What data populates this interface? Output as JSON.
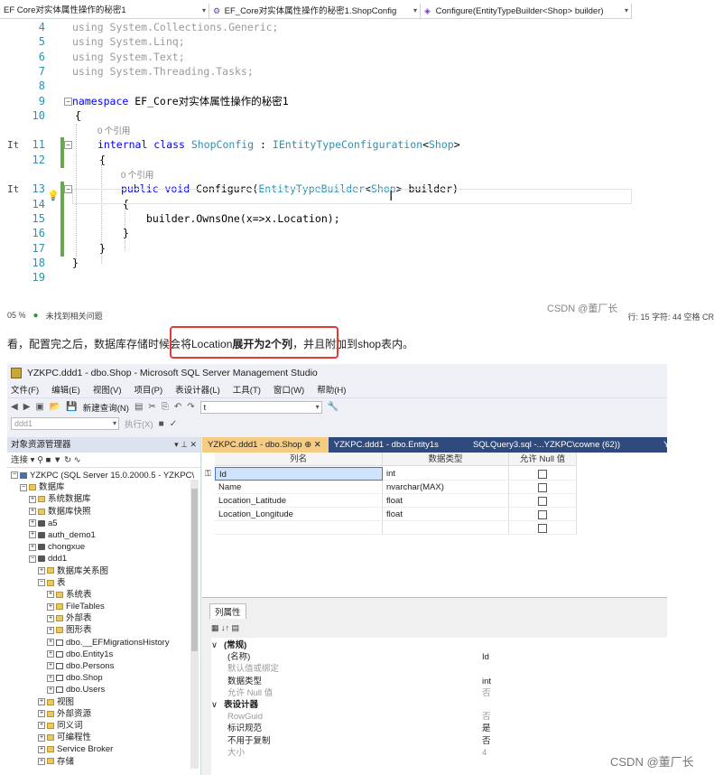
{
  "vs": {
    "nav": {
      "project": "EF Core对实体属性操作的秘密1",
      "type": "EF_Core对实体属性操作的秘密1.ShopConfig",
      "member": "Configure(EntityTypeBuilder<Shop> builder)"
    },
    "lines": [
      {
        "n": "4",
        "parts": [
          {
            "c": "us",
            "t": "using System.Collections.Generic;"
          }
        ]
      },
      {
        "n": "5",
        "parts": [
          {
            "c": "us",
            "t": "using System.Linq;"
          }
        ]
      },
      {
        "n": "6",
        "parts": [
          {
            "c": "us",
            "t": "using System.Text;"
          }
        ]
      },
      {
        "n": "7",
        "parts": [
          {
            "c": "us",
            "t": "using System.Threading.Tasks;"
          }
        ]
      },
      {
        "n": "8",
        "parts": []
      },
      {
        "n": "9",
        "parts": [
          {
            "c": "kw",
            "t": "namespace"
          },
          {
            "c": "pl",
            "t": " EF_Core对实体属性操作的秘密1"
          }
        ]
      },
      {
        "n": "10",
        "parts": [
          {
            "c": "pl",
            "t": "{"
          }
        ]
      },
      {
        "n": "",
        "ref": "0 个引用"
      },
      {
        "n": "11",
        "parts": [
          {
            "c": "kw",
            "t": "internal class "
          },
          {
            "c": "ty",
            "t": "ShopConfig"
          },
          {
            "c": "pl",
            "t": " : "
          },
          {
            "c": "ty",
            "t": "IEntityTypeConfiguration"
          },
          {
            "c": "pl",
            "t": "<"
          },
          {
            "c": "ty",
            "t": "Shop"
          },
          {
            "c": "pl",
            "t": ">"
          }
        ]
      },
      {
        "n": "12",
        "parts": [
          {
            "c": "pl",
            "t": "{"
          }
        ]
      },
      {
        "n": "",
        "ref": "0 个引用"
      },
      {
        "n": "13",
        "parts": [
          {
            "c": "kw",
            "t": "public void "
          },
          {
            "c": "pl",
            "t": "Configure("
          },
          {
            "c": "ty",
            "t": "EntityTypeBuilder"
          },
          {
            "c": "pl",
            "t": "<"
          },
          {
            "c": "ty",
            "t": "Shop"
          },
          {
            "c": "pl",
            "t": "> builder)"
          }
        ]
      },
      {
        "n": "14",
        "parts": [
          {
            "c": "pl",
            "t": "{"
          }
        ]
      },
      {
        "n": "15",
        "parts": [
          {
            "c": "pl",
            "t": "builder.OwnsOne(x=>x.Location);"
          }
        ]
      },
      {
        "n": "16",
        "parts": [
          {
            "c": "pl",
            "t": "}"
          }
        ]
      },
      {
        "n": "17",
        "parts": [
          {
            "c": "pl",
            "t": "}"
          }
        ]
      },
      {
        "n": "18",
        "parts": [
          {
            "c": "pl",
            "t": "}"
          }
        ]
      },
      {
        "n": "19",
        "parts": []
      }
    ],
    "status": {
      "zoom": "05 %",
      "issues": "未找到相关问题",
      "position": "行: 15    字符: 44    空格    CR"
    },
    "watermark": "CSDN @董厂长"
  },
  "caption": {
    "before": "看，配置完之后，数据库存储时候会将Location",
    "bold": "展开为2个列",
    "after": "，并且附加到shop表内。"
  },
  "ssms": {
    "title": "YZKPC.ddd1 - dbo.Shop - Microsoft SQL Server Management Studio",
    "menu": [
      "文件(F)",
      "编辑(E)",
      "视图(V)",
      "项目(P)",
      "表设计器(L)",
      "工具(T)",
      "窗口(W)",
      "帮助(H)"
    ],
    "toolbar": {
      "new_query": "新建查询(N)",
      "db_combo": "ddd1",
      "execute": "执行(X)",
      "search_combo": "t"
    },
    "object_explorer": {
      "title": "对象资源管理器",
      "connect": "连接",
      "nodes": [
        {
          "label": "YZKPC (SQL Server 15.0.2000.5 - YZKPC\\",
          "indent": 0,
          "exp": "−",
          "icon": "srv"
        },
        {
          "label": "数据库",
          "indent": 1,
          "exp": "−",
          "icon": "folder"
        },
        {
          "label": "系统数据库",
          "indent": 2,
          "exp": "+",
          "icon": "folder"
        },
        {
          "label": "数据库快照",
          "indent": 2,
          "exp": "+",
          "icon": "folder"
        },
        {
          "label": "a5",
          "indent": 2,
          "exp": "+",
          "icon": "db"
        },
        {
          "label": "auth_demo1",
          "indent": 2,
          "exp": "+",
          "icon": "db"
        },
        {
          "label": "chongxue",
          "indent": 2,
          "exp": "+",
          "icon": "db"
        },
        {
          "label": "ddd1",
          "indent": 2,
          "exp": "−",
          "icon": "db"
        },
        {
          "label": "数据库关系图",
          "indent": 3,
          "exp": "+",
          "icon": "folder"
        },
        {
          "label": "表",
          "indent": 3,
          "exp": "−",
          "icon": "folder"
        },
        {
          "label": "系统表",
          "indent": 4,
          "exp": "+",
          "icon": "folder"
        },
        {
          "label": "FileTables",
          "indent": 4,
          "exp": "+",
          "icon": "folder"
        },
        {
          "label": "外部表",
          "indent": 4,
          "exp": "+",
          "icon": "folder"
        },
        {
          "label": "图形表",
          "indent": 4,
          "exp": "+",
          "icon": "folder"
        },
        {
          "label": "dbo.__EFMigrationsHistory",
          "indent": 4,
          "exp": "+",
          "icon": "tbl"
        },
        {
          "label": "dbo.Entity1s",
          "indent": 4,
          "exp": "+",
          "icon": "tbl"
        },
        {
          "label": "dbo.Persons",
          "indent": 4,
          "exp": "+",
          "icon": "tbl"
        },
        {
          "label": "dbo.Shop",
          "indent": 4,
          "exp": "+",
          "icon": "tbl"
        },
        {
          "label": "dbo.Users",
          "indent": 4,
          "exp": "+",
          "icon": "tbl"
        },
        {
          "label": "视图",
          "indent": 3,
          "exp": "+",
          "icon": "folder"
        },
        {
          "label": "外部资源",
          "indent": 3,
          "exp": "+",
          "icon": "folder"
        },
        {
          "label": "同义词",
          "indent": 3,
          "exp": "+",
          "icon": "folder"
        },
        {
          "label": "可编程性",
          "indent": 3,
          "exp": "+",
          "icon": "folder"
        },
        {
          "label": "Service Broker",
          "indent": 3,
          "exp": "+",
          "icon": "folder"
        },
        {
          "label": "存储",
          "indent": 3,
          "exp": "+",
          "icon": "folder"
        }
      ]
    },
    "tabs": [
      "YZKPC.ddd1 - dbo.Shop",
      "YZKPC.ddd1 - dbo.Entity1s",
      "SQLQuery3.sql -...YZKPC\\cowne (62))",
      "YZ"
    ],
    "grid": {
      "headers": [
        "列名",
        "数据类型",
        "允许 Null 值"
      ],
      "rows": [
        {
          "name": "Id",
          "type": "int",
          "key": true
        },
        {
          "name": "Name",
          "type": "nvarchar(MAX)"
        },
        {
          "name": "Location_Latitude",
          "type": "float"
        },
        {
          "name": "Location_Longitude",
          "type": "float"
        },
        {
          "name": "",
          "type": ""
        }
      ]
    },
    "props": {
      "tab": "列属性",
      "rows": [
        {
          "k": "(常规)",
          "v": "",
          "cat": true
        },
        {
          "k": "(名称)",
          "v": "Id"
        },
        {
          "k": "默认值或绑定",
          "v": "",
          "grey": true
        },
        {
          "k": "数据类型",
          "v": "int"
        },
        {
          "k": "允许 Null 值",
          "v": "否",
          "grey": true
        },
        {
          "k": "表设计器",
          "v": "",
          "cat": true
        },
        {
          "k": "RowGuid",
          "v": "否",
          "grey": true
        },
        {
          "k": "标识规范",
          "v": "是"
        },
        {
          "k": "不用于复制",
          "v": "否"
        },
        {
          "k": "大小",
          "v": "4",
          "grey": true
        }
      ]
    },
    "watermark": "CSDN @董厂长"
  }
}
